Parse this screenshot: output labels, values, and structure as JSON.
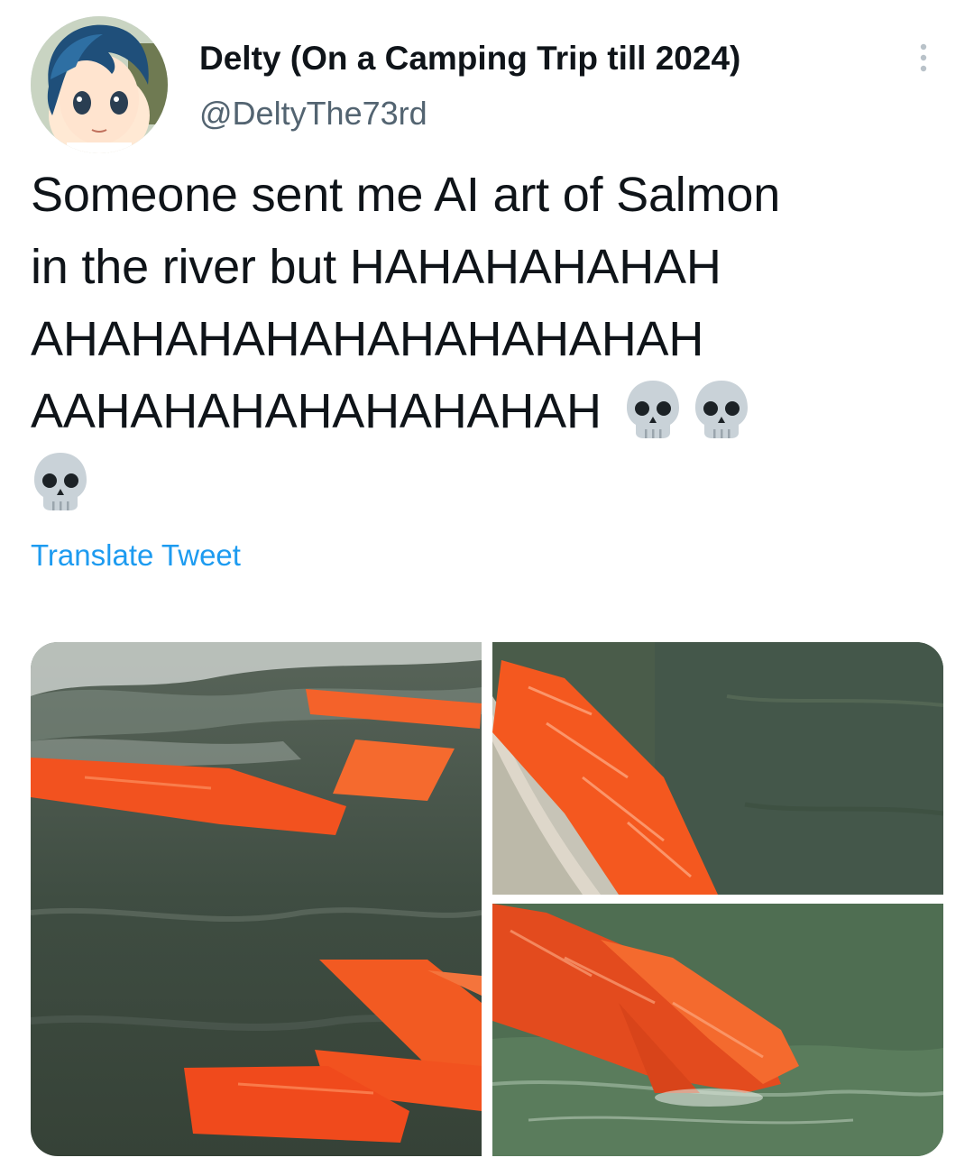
{
  "tweet": {
    "author": {
      "display_name": "Delty (On a Camping Trip till 2024)",
      "handle": "@DeltyThe73rd"
    },
    "text_lines": [
      "Someone sent me AI art of Salmon",
      "in the river but HAHAHAHAHAH",
      "AHAHAHAHAHAHAHAHAHAH",
      "AAHAHAHAHAHAHAHAH"
    ],
    "emoji": [
      "skull",
      "skull",
      "skull"
    ],
    "translate_label": "Translate Tweet",
    "media_count": 3
  },
  "colors": {
    "text": "#0f1419",
    "secondary": "#536471",
    "link": "#1d9bf0",
    "salmon": "#f2521f",
    "water": "#3b4b3c"
  },
  "icons": {
    "more": "more-vertical-icon",
    "emoji": "skull-emoji-icon"
  }
}
